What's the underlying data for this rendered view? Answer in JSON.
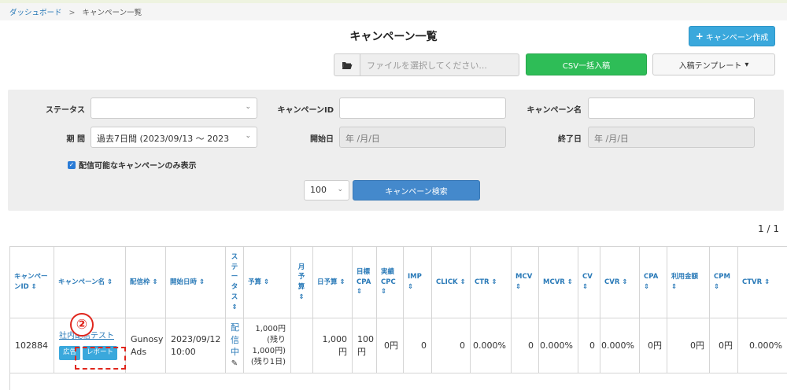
{
  "breadcrumb": {
    "home": "ダッシュボード",
    "sep": ">",
    "current": "キャンペーン一覧"
  },
  "page": {
    "title": "キャンペーン一覧"
  },
  "toolbar": {
    "create_label": "キャンペーン作成",
    "file_placeholder": "ファイルを選択してください...",
    "csv_label": "CSV一括入稿",
    "template_label": "入稿テンプレート",
    "template_caret": "▾",
    "folder_icon": "folder-open-icon"
  },
  "filters": {
    "status_label": "ステータス",
    "status_value": "",
    "campaign_id_label": "キャンペーンID",
    "campaign_id_value": "",
    "campaign_name_label": "キャンペーン名",
    "campaign_name_value": "",
    "period_label": "期 間",
    "period_value": "過去7日間 (2023/09/13 〜 2023",
    "start_label": "開始日",
    "start_placeholder": "年 /月/日",
    "end_label": "終了日",
    "end_placeholder": "年 /月/日",
    "deliverable_only_label": "配信可能なキャンペーンのみ表示",
    "deliverable_only_checked": true,
    "per_page": "100",
    "search_label": "キャンペーン検索"
  },
  "pager": {
    "text": "1 / 1"
  },
  "table": {
    "headers": {
      "id": "キャンペーンID ⇕",
      "name": "キャンペーン名 ⇕",
      "slot": "配信枠 ⇕",
      "start": "開始日時 ⇕",
      "status": "ステータス⇕",
      "budget": "予算 ⇕",
      "monthly": "月予算⇕",
      "daily": "日予算 ⇕",
      "target_cpa": "目標CPA ⇕",
      "actual_cpc": "実績CPC ⇕",
      "imp": "IMP ⇕",
      "click": "CLICK ⇕",
      "ctr": "CTR ⇕",
      "mcv": "MCV ⇕",
      "mcvr": "MCVR ⇕",
      "cv": "CV ⇕",
      "cvr": "CVR ⇕",
      "cpa": "CPA ⇕",
      "spend": "利用金額 ⇕",
      "cpm": "CPM ⇕",
      "ctvr": "CTVR ⇕"
    },
    "row": {
      "id": "102884",
      "name": "社内配信テスト",
      "ad_button": "広告",
      "report_button": "レポート",
      "slot": "Gunosy Ads",
      "start": "2023/09/12 10:00",
      "status": "配信中",
      "budget": "1,000円 (残り1,000円) (残り1日)",
      "monthly": "",
      "daily": "1,000円",
      "target_cpa": "100円",
      "actual_cpc": "0円",
      "imp": "0",
      "click": "0",
      "ctr": "0.000%",
      "mcv": "0",
      "mcvr": "0.000%",
      "cv": "0",
      "cvr": "0.000%",
      "cpa": "0円",
      "spend": "0円",
      "cpm": "0円",
      "ctvr": "0.000%"
    }
  },
  "annotation": {
    "step_marker": "②"
  }
}
